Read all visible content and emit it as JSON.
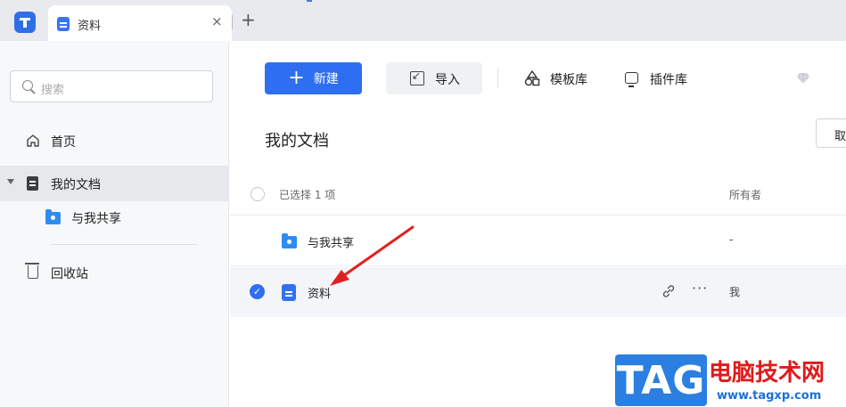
{
  "tabbar": {
    "tab_title": "资料",
    "close_symbol": "×",
    "new_tab_symbol": "+"
  },
  "sidebar": {
    "search_placeholder": "搜索",
    "items": [
      {
        "label": "首页",
        "icon": "home-icon"
      },
      {
        "label": "我的文档",
        "icon": "document-icon",
        "active": true
      },
      {
        "label": "与我共享",
        "icon": "shared-folder-icon"
      },
      {
        "label": "回收站",
        "icon": "trash-icon"
      }
    ]
  },
  "toolbar": {
    "new_label": "新建",
    "import_label": "导入",
    "templates_label": "模板库",
    "plugins_label": "插件库"
  },
  "main": {
    "section_title": "我的文档",
    "cancel_label": "取",
    "header": {
      "selected_text": "已选择 1 项",
      "owner_col": "所有者"
    },
    "rows": [
      {
        "name": "与我共享",
        "owner": "-",
        "type": "shared-folder",
        "selected": false
      },
      {
        "name": "资料",
        "owner": "我",
        "type": "document",
        "selected": true
      }
    ],
    "row_actions": {
      "link_symbol": "🔗",
      "more_symbol": "···"
    }
  },
  "colors": {
    "accent": "#2d6ff0",
    "sidebar_bg": "#f7f8fa",
    "selected_row_bg": "#f3f5f8",
    "annotation_arrow": "#e02020"
  },
  "watermark": {
    "badge": "TAG",
    "site_name": "电脑技术网",
    "url": "www.tagxp.com"
  }
}
